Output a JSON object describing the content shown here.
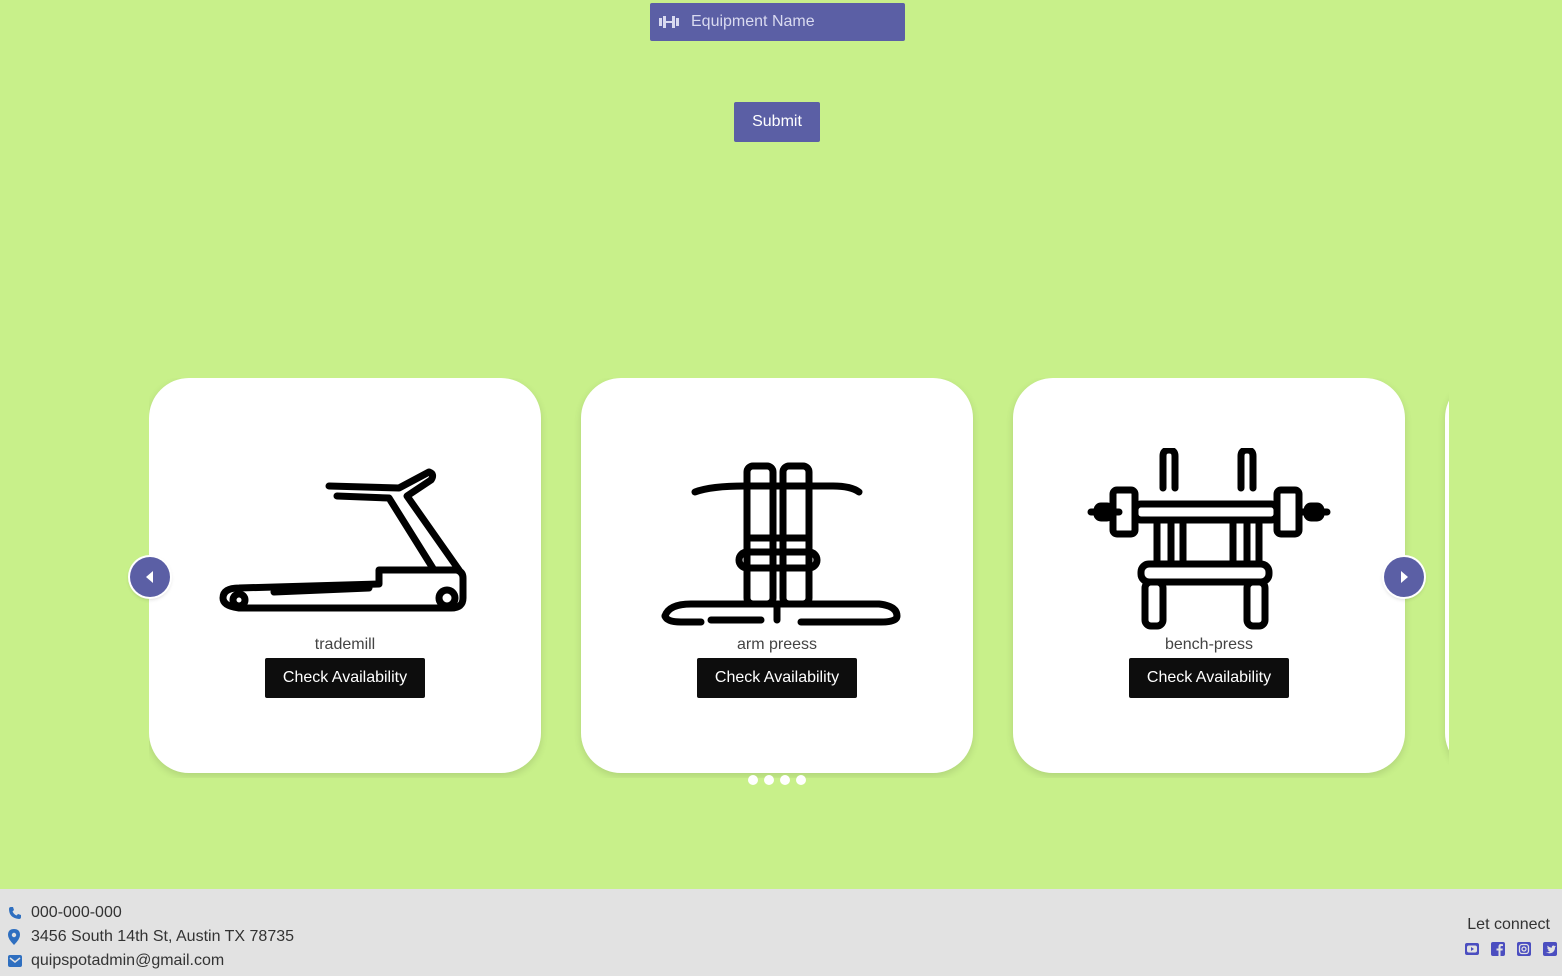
{
  "search": {
    "placeholder": "Equipment Name",
    "icon": "dumbbell-icon"
  },
  "submit_label": "Submit",
  "carousel": {
    "cards": [
      {
        "name": "trademill",
        "button": "Check Availability",
        "icon": "treadmill-icon"
      },
      {
        "name": "arm preess",
        "button": "Check Availability",
        "icon": "arm-press-icon"
      },
      {
        "name": "bench-press",
        "button": "Check Availability",
        "icon": "bench-press-icon"
      }
    ],
    "dot_count": 4
  },
  "footer": {
    "phone": "000-000-000",
    "address": "3456 South 14th St, Austin TX 78735",
    "email": "quipspotadmin@gmail.com",
    "connect_label": "Let connect",
    "socials": [
      "youtube-icon",
      "facebook-icon",
      "instagram-icon",
      "twitter-icon"
    ]
  },
  "colors": {
    "background": "#c8f08a",
    "accent": "#5b5fa5",
    "footer": "#e2e2e2",
    "button_dark": "#0d0d0d"
  }
}
